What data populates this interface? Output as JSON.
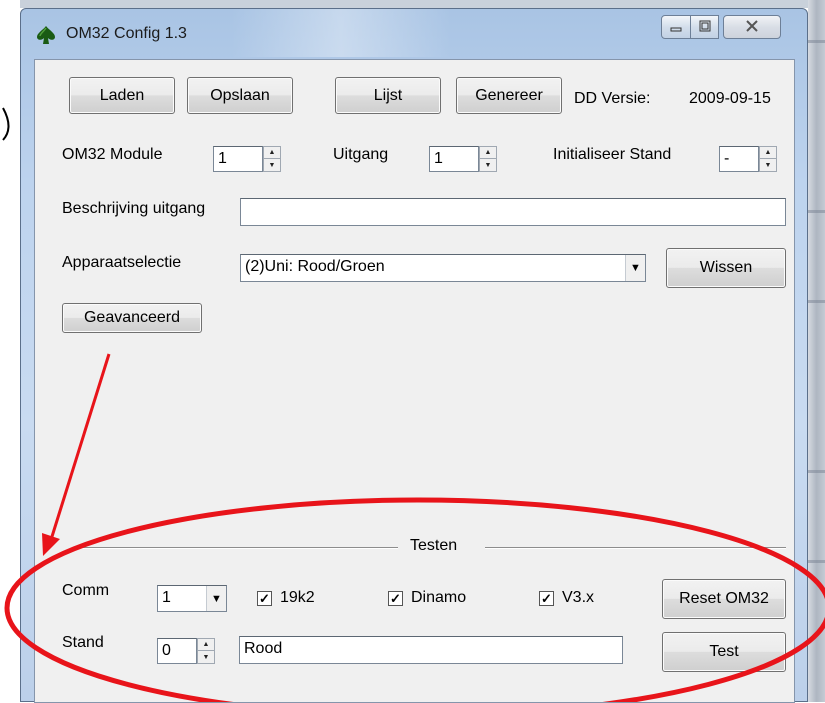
{
  "window": {
    "title": "OM32 Config 1.3",
    "icon": "spade-icon",
    "caption_buttons": [
      "minimize-icon",
      "maximize-icon",
      "close-icon"
    ]
  },
  "toolbar": {
    "load_label": "Laden",
    "save_label": "Opslaan",
    "list_label": "Lijst",
    "generate_label": "Genereer",
    "dd_version_label": "DD Versie:",
    "dd_version_value": "2009-09-15"
  },
  "module_row": {
    "module_label": "OM32 Module",
    "module_value": "1",
    "output_label": "Uitgang",
    "output_value": "1",
    "init_label": "Initialiseer Stand",
    "init_value": "-"
  },
  "description": {
    "label": "Beschrijving uitgang",
    "value": ""
  },
  "device": {
    "label": "Apparaatselectie",
    "selected": "(2)Uni: Rood/Groen",
    "clear_label": "Wissen"
  },
  "advanced_label": "Geavanceerd",
  "test_group": {
    "title": "Testen",
    "comm_label": "Comm",
    "comm_value": "1",
    "checkboxes": [
      {
        "label": "19k2",
        "checked": true
      },
      {
        "label": "Dinamo",
        "checked": true
      },
      {
        "label": "V3.x",
        "checked": true
      }
    ],
    "reset_label": "Reset OM32",
    "stand_label": "Stand",
    "stand_value": "0",
    "stand_text": "Rood",
    "test_label": "Test"
  },
  "colors": {
    "annotation_red": "#e8141a",
    "window_frame": "#bcd0ea",
    "client_bg": "#f0f0f0"
  }
}
